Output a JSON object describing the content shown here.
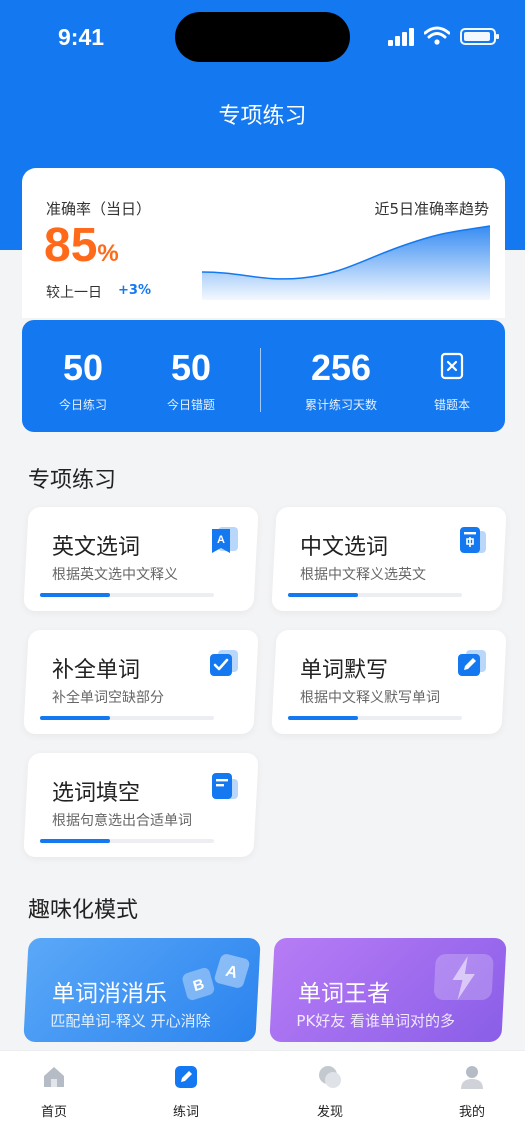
{
  "status": {
    "time": "9:41"
  },
  "nav": {
    "title": "专项练习"
  },
  "accuracy": {
    "label": "准确率（当日）",
    "value": "85",
    "unit": "%",
    "compare_label": "较上一日",
    "delta": "+3%",
    "trend_title": "近5日准确率趋势"
  },
  "stats": {
    "items": [
      {
        "num": "50",
        "label": "今日练习"
      },
      {
        "num": "50",
        "label": "今日错题"
      },
      {
        "num": "256",
        "label": "累计练习天数"
      }
    ],
    "wrong_book_label": "错题本"
  },
  "section_practice": {
    "title": "专项练习"
  },
  "practice_cards": [
    {
      "title": "英文选词",
      "subtitle": "根据英文选中文释义",
      "progress": 0.4,
      "icon": "bookmark-a-icon"
    },
    {
      "title": "中文选词",
      "subtitle": "根据中文释义选英文",
      "progress": 0.4,
      "icon": "book-zh-icon"
    },
    {
      "title": "补全单词",
      "subtitle": "补全单词空缺部分",
      "progress": 0.4,
      "icon": "check-icon"
    },
    {
      "title": "单词默写",
      "subtitle": "根据中文释义默写单词",
      "progress": 0.4,
      "icon": "pencil-icon"
    },
    {
      "title": "选词填空",
      "subtitle": "根据句意选出合适单词",
      "progress": 0.4,
      "icon": "book-icon"
    }
  ],
  "section_fun": {
    "title": "趣味化模式"
  },
  "fun_cards": [
    {
      "title": "单词消消乐",
      "subtitle": "匹配单词-释义 开心消除"
    },
    {
      "title": "单词王者",
      "subtitle": "PK好友 看谁单词对的多"
    }
  ],
  "tabs": [
    {
      "label": "首页",
      "icon": "home-icon"
    },
    {
      "label": "练词",
      "icon": "practice-icon"
    },
    {
      "label": "发现",
      "icon": "discover-icon"
    },
    {
      "label": "我的",
      "icon": "profile-icon"
    }
  ],
  "colors": {
    "primary": "#1478f0",
    "accent": "#ff6a1a"
  }
}
